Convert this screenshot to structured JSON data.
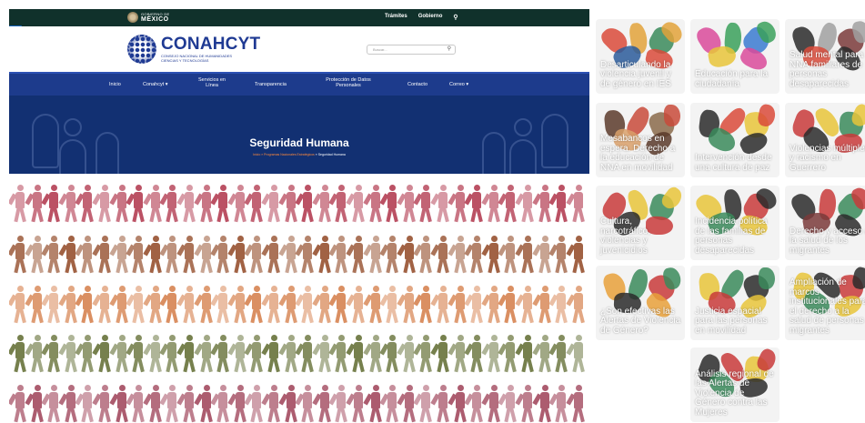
{
  "site": {
    "gov_logo_small": "GOBIERNO DE",
    "gov_logo_big": "MÉXICO",
    "top_links": [
      "Trámites",
      "Gobierno"
    ],
    "search_icon": "search-icon",
    "access_icon": "accessibility-icon",
    "brand_name": "CONAHCYT",
    "brand_sub": "CONSEJO NACIONAL DE HUMANIDADES CIENCIAS Y TECNOLOGÍAS",
    "search_placeholder": "Buscar...",
    "nav": [
      "Inicio",
      "Conahcyt ▾",
      "Servicios en Línea",
      "Transparencia",
      "Protección de Datos Personales",
      "Contacto",
      "Correo ▾"
    ],
    "hero_title": "Seguridad Humana",
    "breadcrumb_prefix": "Inicio » Programas Nacionales Estratégicos",
    "breadcrumb_current": " » Seguridad Humana",
    "colors": {
      "topbar": "#10312b",
      "navbar": "#1d3b8c",
      "hero": "#123072",
      "accent": "#ff8a3d"
    },
    "figure_rows": [
      "#b8485c",
      "#9c5a3a",
      "#d98a5a",
      "#6f7a44",
      "#a85468"
    ]
  },
  "tiles": [
    {
      "caption": "Desarticulando la violencia juvenil y de género en IES",
      "art": "circle-of-people"
    },
    {
      "caption": "Educación para la ciudadanía",
      "art": "colorful-figures"
    },
    {
      "caption": "Salud mental para NNA familiares de personas desaparecidas",
      "art": "figures"
    },
    {
      "caption": "Mesabancos en espera. Derecho a la educación de NNA en movilidad",
      "art": "crowd"
    },
    {
      "caption": "Intervención desde una cultura de paz",
      "art": "running-figures"
    },
    {
      "caption": "Violencias múltiples y racismo en Guerrero",
      "art": "figures"
    },
    {
      "caption": "Cultura, narcotráfico, violencias y juvenicidios",
      "art": "figures"
    },
    {
      "caption": "Incidencia política de las familias de personas desaparecidas",
      "art": "figures"
    },
    {
      "caption": "Derecho y acceso a la salud de los migrantes",
      "art": "figures"
    },
    {
      "caption": "¿Son efectivas las Alertas de Violencia de Género?",
      "art": "figures"
    },
    {
      "caption": "Justicia espacial para las personas en movilidad",
      "art": "figures"
    },
    {
      "caption": "Ampliación de marcos institucionales para el derecho a la salud de personas migrantes",
      "art": "figures"
    },
    {
      "caption": "Análisis regional de las Alertas de Violencia de Género contra las Mujeres",
      "art": "figures"
    }
  ]
}
